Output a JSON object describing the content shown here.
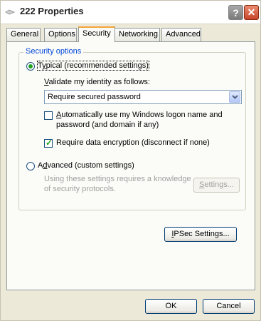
{
  "window": {
    "title": "222 Properties",
    "help_label": "?",
    "close_label": "✕"
  },
  "tabs": [
    {
      "label": "General",
      "active": false
    },
    {
      "label": "Options",
      "active": false
    },
    {
      "label": "Security",
      "active": true
    },
    {
      "label": "Networking",
      "active": false
    },
    {
      "label": "Advanced",
      "active": false
    }
  ],
  "security": {
    "group_label": "Security options",
    "typical": {
      "prefix": "T",
      "hotkey": "y",
      "rest": "pical (recommended settings)",
      "selected": true
    },
    "validate": {
      "hotkey": "V",
      "rest": "alidate my identity as follows:"
    },
    "validate_select": {
      "value": "Require secured password",
      "arrow_icon": "chevron-down-icon"
    },
    "auto_logon": {
      "hotkey": "A",
      "rest": "utomatically use my Windows logon name and",
      "line2": "password (and domain if any)",
      "checked": false
    },
    "encryption": {
      "label": "Require data encryption (disconnect if none)",
      "checked": true
    },
    "advanced": {
      "prefix": "A",
      "hotkey": "d",
      "rest": "vanced (custom settings)",
      "selected": false
    },
    "advanced_note_line1": "Using these settings requires a knowledge",
    "advanced_note_line2": "of security protocols.",
    "settings_button": {
      "hotkey": "S",
      "rest": "ettings...",
      "enabled": false
    }
  },
  "ipsec_button": {
    "hotkey": "I",
    "rest": "PSec Settings..."
  },
  "footer": {
    "ok_label": "OK",
    "cancel_label": "Cancel"
  },
  "colors": {
    "tab_highlight": "#f3a53a",
    "group_label": "#0046d5",
    "check_green": "#21a121",
    "close_red": "#c8452a"
  }
}
